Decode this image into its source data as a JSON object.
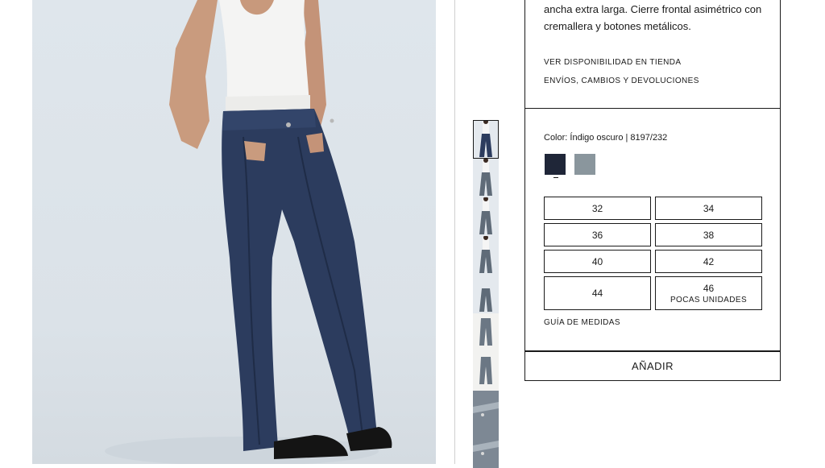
{
  "product": {
    "description": "ancha extra larga. Cierre frontal asimétrico con cremallera y botones metálicos.",
    "store_availability_link": "VER DISPONIBILIDAD EN TIENDA",
    "shipping_link": "ENVÍOS, CAMBIOS Y DEVOLUCIONES",
    "color_label": "Color: Índigo oscuro | 8197/232",
    "swatches": [
      {
        "name": "Índigo oscuro",
        "color": "#1f2638",
        "selected": true
      },
      {
        "name": "Gris",
        "color": "#8a969d",
        "selected": false
      }
    ],
    "sizes": [
      {
        "label": "32",
        "note": ""
      },
      {
        "label": "34",
        "note": ""
      },
      {
        "label": "36",
        "note": ""
      },
      {
        "label": "38",
        "note": ""
      },
      {
        "label": "40",
        "note": ""
      },
      {
        "label": "42",
        "note": ""
      },
      {
        "label": "44",
        "note": ""
      },
      {
        "label": "46",
        "note": "POCAS UNIDADES"
      }
    ],
    "size_guide_link": "GUÍA DE MEDIDAS",
    "add_button": "AÑADIR"
  },
  "gallery": {
    "thumbnail_count": 9
  },
  "colors": {
    "denim": "#2c3c5e",
    "background": "#dfe6ec",
    "border": "#1a1a1a"
  }
}
